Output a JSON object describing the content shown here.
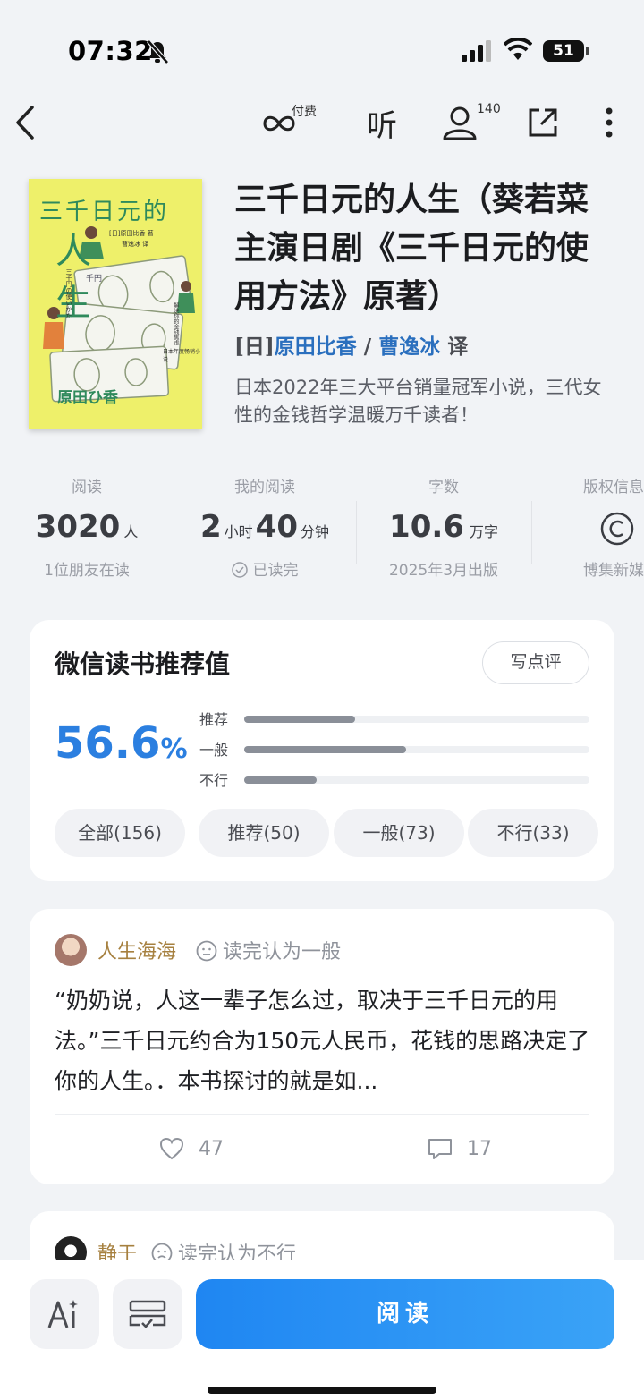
{
  "status_bar": {
    "time": "07:32",
    "battery": "51"
  },
  "nav": {
    "paid_label": "付费",
    "listen_label": "听",
    "friends_count": "140"
  },
  "book": {
    "title": "三千日元的人生（葵若菜主演日剧《三千日元的使用方法》原著）",
    "author_prefix": "[日]",
    "author": "原田比香",
    "translator": "曹逸冰",
    "translator_suffix": "译",
    "description": "日本2022年三大平台销量冠军小说，三代女性的金钱哲学温暖万千读者！",
    "cover": {
      "title": "三千日元的",
      "title_big": "人生",
      "subtitle_jp": "三千円の使いかた",
      "author_jp": "原田ひ香",
      "author_cn": "[日]原田比香 著",
      "translator_cn": "曹逸冰 译",
      "note": "日本年度畅销小说",
      "note2": "解决你的金钱焦虑",
      "bill_text": "千円",
      "color": "#eef06a"
    }
  },
  "stats": [
    {
      "label": "阅读",
      "value": "3020",
      "unit": "人",
      "sub": "1位朋友在读"
    },
    {
      "label": "我的阅读",
      "value_h": "2",
      "unit_h": "小时",
      "value_m": "40",
      "unit_m": "分钟",
      "sub": "已读完"
    },
    {
      "label": "字数",
      "value": "10.6",
      "unit": "万字",
      "sub": "2025年3月出版"
    },
    {
      "label": "版权信息",
      "icon": "copyright-icon",
      "sub": "博集新媒"
    }
  ],
  "recommend": {
    "title": "微信读书推荐值",
    "write_label": "写点评",
    "percent": "56.6",
    "percent_sign": "%",
    "bars": [
      {
        "label": "推荐",
        "value": 0.32
      },
      {
        "label": "一般",
        "value": 0.47
      },
      {
        "label": "不行",
        "value": 0.21
      }
    ],
    "filters": [
      "全部(156)",
      "推荐(50)",
      "一般(73)",
      "不行(33)"
    ],
    "accent": "#2b7fe0"
  },
  "reviews": [
    {
      "name": "人生海海",
      "verdict": "读完认为一般",
      "text": "“奶奶说，人这一辈子怎么过，取决于三千日元的用法。”三千日元约合为150元人民币，花钱的思路决定了你的人生。．本书探讨的就是如...",
      "likes": "47",
      "comments": "17"
    },
    {
      "name": "静于",
      "verdict": "读完认为不行"
    }
  ],
  "bottom": {
    "read_label": "阅读"
  }
}
